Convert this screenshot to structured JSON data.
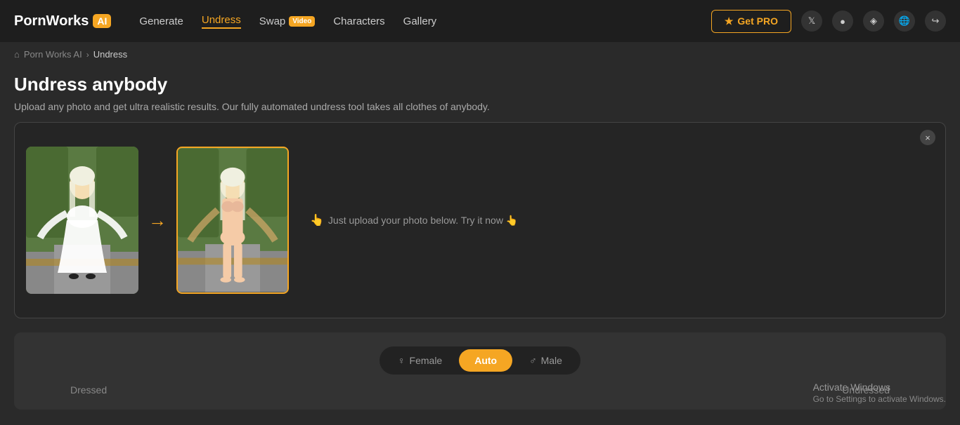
{
  "app": {
    "logo_text": "PornWorks",
    "logo_badge": "AI"
  },
  "nav": {
    "generate": "Generate",
    "undress": "Undress",
    "swap": "Swap",
    "swap_badge": "Video",
    "characters": "Characters",
    "gallery": "Gallery"
  },
  "header": {
    "get_pro": "Get PRO"
  },
  "breadcrumb": {
    "home": "Porn Works AI",
    "separator": "›",
    "current": "Undress"
  },
  "page": {
    "title": "Undress anybody",
    "subtitle": "Upload any photo and get ultra realistic results. Our fully automated undress tool takes all clothes of anybody.",
    "upload_hint": "Just upload your photo below. Try it now 👆"
  },
  "gender_toggle": {
    "female": "Female",
    "auto": "Auto",
    "male": "Male"
  },
  "labels": {
    "dressed": "Dressed",
    "undressed": "Undressed"
  },
  "activation": {
    "title": "Activate Windows",
    "subtitle": "Go to Settings to activate Windows."
  },
  "icons": {
    "star": "★",
    "arrow": "→",
    "close": "×",
    "home": "⌂",
    "female_symbol": "♀",
    "male_symbol": "♂",
    "x_social": "𝕏",
    "reddit": "🔴",
    "discord": "💬",
    "globe": "🌐",
    "login": "⬚"
  }
}
